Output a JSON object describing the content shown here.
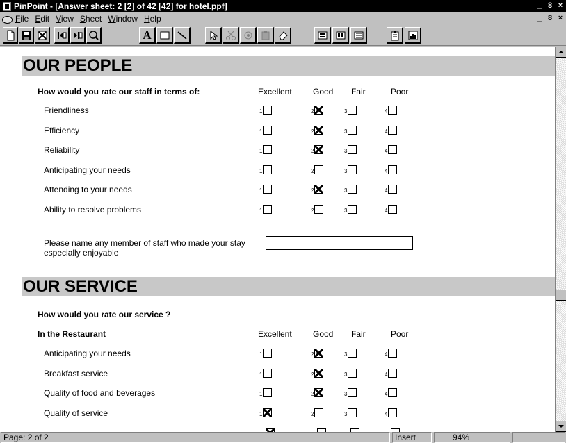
{
  "window": {
    "title": "PinPoint - [Answer sheet: 2 [2] of 42 [42] for hotel.ppf]",
    "controls": [
      "_",
      "8",
      "×"
    ]
  },
  "menu": {
    "items": [
      "File",
      "Edit",
      "View",
      "Sheet",
      "Window",
      "Help"
    ],
    "accelerators": [
      "F",
      "E",
      "V",
      "S",
      "W",
      "H"
    ]
  },
  "toolbar": {
    "icons": [
      "new-icon",
      "save-icon",
      "delete-icon",
      "first-record-icon",
      "last-record-icon",
      "find-icon",
      "text-tool-icon",
      "rectangle-tool-icon",
      "line-tool-icon",
      "pointer-tool-icon",
      "cut-icon",
      "copy-icon",
      "paste-icon",
      "erase-icon",
      "view-icon",
      "view-2-icon",
      "view-3-icon",
      "clipboard-icon",
      "chart-icon"
    ],
    "text_tool_label": "A"
  },
  "sections": [
    {
      "title": "OUR PEOPLE",
      "question": "How would you rate our staff in terms of:",
      "columns": [
        "Excellent",
        "Good",
        "Fair",
        "Poor"
      ],
      "rows": [
        {
          "label": "Friendliness",
          "checked": 2
        },
        {
          "label": "Efficiency",
          "checked": 2
        },
        {
          "label": "Reliability",
          "checked": 2
        },
        {
          "label": "Anticipating your needs",
          "checked": 0
        },
        {
          "label": "Attending to your needs",
          "checked": 2
        },
        {
          "label": "Ability to resolve problems",
          "checked": 0
        }
      ],
      "name_prompt": "Please name any member of staff who made your stay especially enjoyable",
      "name_value": ""
    },
    {
      "title": "OUR SERVICE",
      "question": "How would you rate our service ?",
      "subheading": "In the Restaurant",
      "columns": [
        "Excellent",
        "Good",
        "Fair",
        "Poor"
      ],
      "rows": [
        {
          "label": "Anticipating your needs",
          "checked": 2
        },
        {
          "label": "Breakfast service",
          "checked": 2
        },
        {
          "label": "Quality of food and beverages",
          "checked": 2
        },
        {
          "label": "Quality of service",
          "checked": 1
        }
      ],
      "partial_row_checked": 1
    }
  ],
  "option_numbers": [
    "1",
    "2",
    "3",
    "4"
  ],
  "status": {
    "page": "Page: 2 of 2",
    "mode": "Insert",
    "zoom": "94%"
  },
  "colors": {
    "titlebar": "#000000",
    "chrome": "#c0c0c0",
    "section_band": "#c8c8c8"
  }
}
